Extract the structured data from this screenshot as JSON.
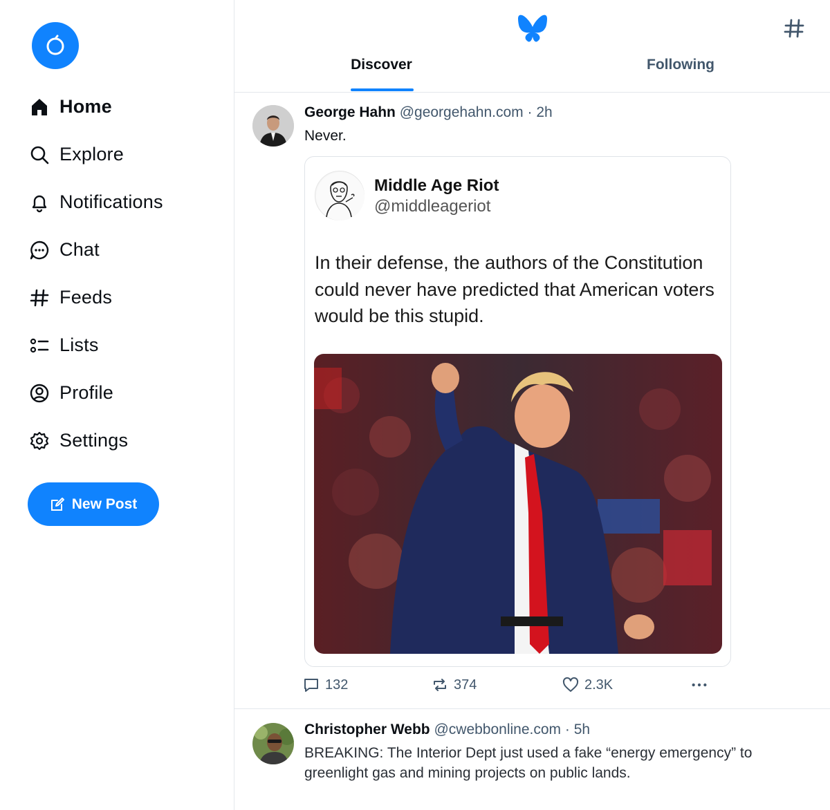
{
  "sidebar": {
    "nav": [
      {
        "label": "Home",
        "icon": "home-icon",
        "active": true
      },
      {
        "label": "Explore",
        "icon": "search-icon"
      },
      {
        "label": "Notifications",
        "icon": "bell-icon"
      },
      {
        "label": "Chat",
        "icon": "chat-icon"
      },
      {
        "label": "Feeds",
        "icon": "hash-icon"
      },
      {
        "label": "Lists",
        "icon": "list-icon"
      },
      {
        "label": "Profile",
        "icon": "person-icon"
      },
      {
        "label": "Settings",
        "icon": "gear-icon"
      }
    ],
    "new_post_label": "New Post"
  },
  "header": {
    "tabs": [
      {
        "label": "Discover",
        "active": true
      },
      {
        "label": "Following"
      }
    ]
  },
  "posts": [
    {
      "name": "George Hahn",
      "handle": "@georgehahn.com",
      "separator": "·",
      "time": "2h",
      "text": "Never.",
      "embed": {
        "name": "Middle Age Riot",
        "handle": "@middleageriot",
        "text": "In their defense, the authors of the Constitution could never have predicted that American voters would be this stupid."
      },
      "counts": {
        "replies": "132",
        "reposts": "374",
        "likes": "2.3K"
      }
    },
    {
      "name": "Christopher Webb",
      "handle": "@cwebbonline.com",
      "separator": "·",
      "time": "5h",
      "text": "BREAKING: The Interior Dept just used a fake “energy emergency” to greenlight gas and mining projects on public lands."
    }
  ],
  "colors": {
    "accent": "#1083fe",
    "muted": "#42576c",
    "border": "#e3e7ec"
  }
}
